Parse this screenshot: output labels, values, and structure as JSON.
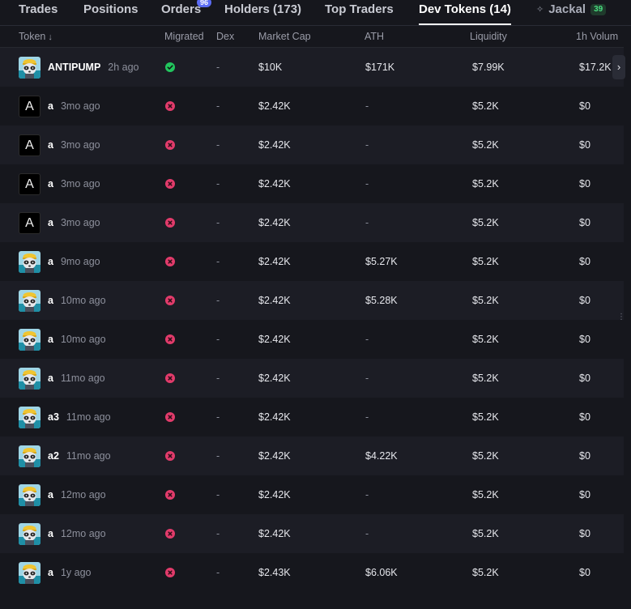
{
  "tabs": [
    {
      "label": "Trades",
      "active": false
    },
    {
      "label": "Positions",
      "active": false
    },
    {
      "label": "Orders",
      "active": false,
      "badge": "96"
    },
    {
      "label": "Holders (173)",
      "active": false
    },
    {
      "label": "Top Traders",
      "active": false
    },
    {
      "label": "Dev Tokens (14)",
      "active": true
    },
    {
      "label": "Jackal",
      "active": false,
      "badge": "39"
    }
  ],
  "table": {
    "headers": {
      "token": "Token",
      "migrated": "Migrated",
      "dex": "Dex",
      "market_cap": "Market Cap",
      "ath": "ATH",
      "liquidity": "Liquidity",
      "volume": "1h Volum"
    },
    "rows": [
      {
        "avatar": "raccoon",
        "name": "ANTIPUMP",
        "age": "2h ago",
        "migrated": true,
        "dex": "-",
        "market_cap": "$10K",
        "ath": "$171K",
        "liquidity": "$7.99K",
        "volume": "$17.2K"
      },
      {
        "avatar": "letter",
        "avatar_letter": "A",
        "name": "a",
        "age": "3mo ago",
        "migrated": false,
        "dex": "-",
        "market_cap": "$2.42K",
        "ath": "-",
        "liquidity": "$5.2K",
        "volume": "$0"
      },
      {
        "avatar": "letter",
        "avatar_letter": "A",
        "name": "a",
        "age": "3mo ago",
        "migrated": false,
        "dex": "-",
        "market_cap": "$2.42K",
        "ath": "-",
        "liquidity": "$5.2K",
        "volume": "$0"
      },
      {
        "avatar": "letter",
        "avatar_letter": "A",
        "name": "a",
        "age": "3mo ago",
        "migrated": false,
        "dex": "-",
        "market_cap": "$2.42K",
        "ath": "-",
        "liquidity": "$5.2K",
        "volume": "$0"
      },
      {
        "avatar": "letter",
        "avatar_letter": "A",
        "name": "a",
        "age": "3mo ago",
        "migrated": false,
        "dex": "-",
        "market_cap": "$2.42K",
        "ath": "-",
        "liquidity": "$5.2K",
        "volume": "$0"
      },
      {
        "avatar": "raccoon",
        "name": "a",
        "age": "9mo ago",
        "migrated": false,
        "dex": "-",
        "market_cap": "$2.42K",
        "ath": "$5.27K",
        "liquidity": "$5.2K",
        "volume": "$0"
      },
      {
        "avatar": "raccoon",
        "name": "a",
        "age": "10mo ago",
        "migrated": false,
        "dex": "-",
        "market_cap": "$2.42K",
        "ath": "$5.28K",
        "liquidity": "$5.2K",
        "volume": "$0"
      },
      {
        "avatar": "raccoon",
        "name": "a",
        "age": "10mo ago",
        "migrated": false,
        "dex": "-",
        "market_cap": "$2.42K",
        "ath": "-",
        "liquidity": "$5.2K",
        "volume": "$0"
      },
      {
        "avatar": "raccoon",
        "name": "a",
        "age": "11mo ago",
        "migrated": false,
        "dex": "-",
        "market_cap": "$2.42K",
        "ath": "-",
        "liquidity": "$5.2K",
        "volume": "$0"
      },
      {
        "avatar": "raccoon",
        "name": "a3",
        "age": "11mo ago",
        "migrated": false,
        "dex": "-",
        "market_cap": "$2.42K",
        "ath": "-",
        "liquidity": "$5.2K",
        "volume": "$0"
      },
      {
        "avatar": "raccoon",
        "name": "a2",
        "age": "11mo ago",
        "migrated": false,
        "dex": "-",
        "market_cap": "$2.42K",
        "ath": "$4.22K",
        "liquidity": "$5.2K",
        "volume": "$0"
      },
      {
        "avatar": "raccoon",
        "name": "a",
        "age": "12mo ago",
        "migrated": false,
        "dex": "-",
        "market_cap": "$2.42K",
        "ath": "-",
        "liquidity": "$5.2K",
        "volume": "$0"
      },
      {
        "avatar": "raccoon",
        "name": "a",
        "age": "12mo ago",
        "migrated": false,
        "dex": "-",
        "market_cap": "$2.42K",
        "ath": "-",
        "liquidity": "$5.2K",
        "volume": "$0"
      },
      {
        "avatar": "raccoon",
        "name": "a",
        "age": "1y ago",
        "migrated": false,
        "dex": "-",
        "market_cap": "$2.43K",
        "ath": "$6.06K",
        "liquidity": "$5.2K",
        "volume": "$0"
      }
    ]
  },
  "icons": {
    "sort": "arrow-down-icon",
    "migrated_yes": "check-circle-icon",
    "migrated_no": "x-circle-icon",
    "scroll_right": "chevron-right-icon",
    "resize": "drag-handle-icon",
    "jackal": "sparkle-icon"
  },
  "colors": {
    "background": "#16171d",
    "row_alt": "#1c1d25",
    "migrated_yes": "#22c55e",
    "migrated_no": "#e23b6b",
    "badge_orders": "#5b6cf5",
    "badge_jackal": "#4ade80"
  }
}
